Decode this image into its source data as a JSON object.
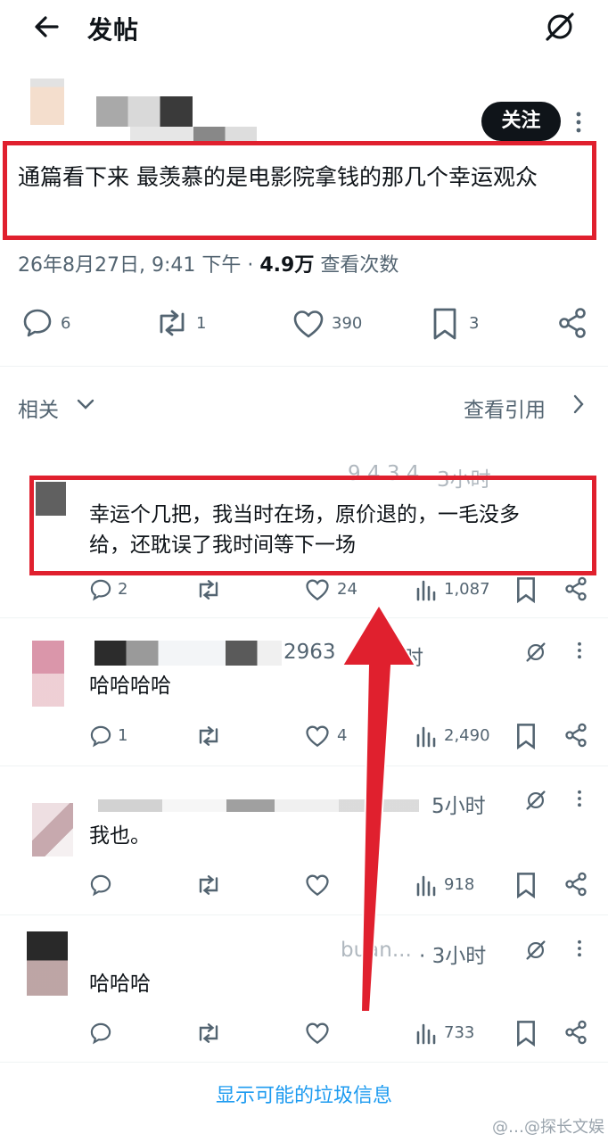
{
  "header": {
    "title": "发帖",
    "back_icon": "arrow-left-icon",
    "grok_icon": "grok-icon"
  },
  "post": {
    "follow_label": "关注",
    "text": "通篇看下来 最羡慕的是电影院拿钱的那几个幸运观众",
    "date": "26年8月27日, 9:41 下午 · ",
    "views": "4.9万",
    "views_label": " 查看次数",
    "stats": {
      "replies": "6",
      "reposts": "1",
      "likes": "390",
      "bookmarks": "3"
    }
  },
  "related": {
    "label": "相关",
    "quotes_label": "查看引用"
  },
  "replies": [
    {
      "handle_fragment": "9 4 3 4",
      "time": "3小时",
      "text_line1": "幸运个几把，我当时在场，原价退的，一毛没多",
      "text_line2": "给，还耽误了我时间等下一场",
      "replies": "2",
      "likes": "24",
      "views": "1,087"
    },
    {
      "handle_fragment": "2963",
      "time": "时",
      "text": "哈哈哈哈",
      "replies": "1",
      "likes": "4",
      "views": "2,490"
    },
    {
      "time": "5小时",
      "text": "我也。",
      "views": "918"
    },
    {
      "handle_fragment": "buan...",
      "time": "· 3小时",
      "text": "哈哈哈",
      "views": "733"
    }
  ],
  "footer": {
    "show_spam": "显示可能的垃圾信息",
    "watermark": "@…@探长文娱"
  },
  "colors": {
    "annotation_red": "#e0202e",
    "link_blue": "#1d9bf0",
    "text_gray": "#536471"
  }
}
